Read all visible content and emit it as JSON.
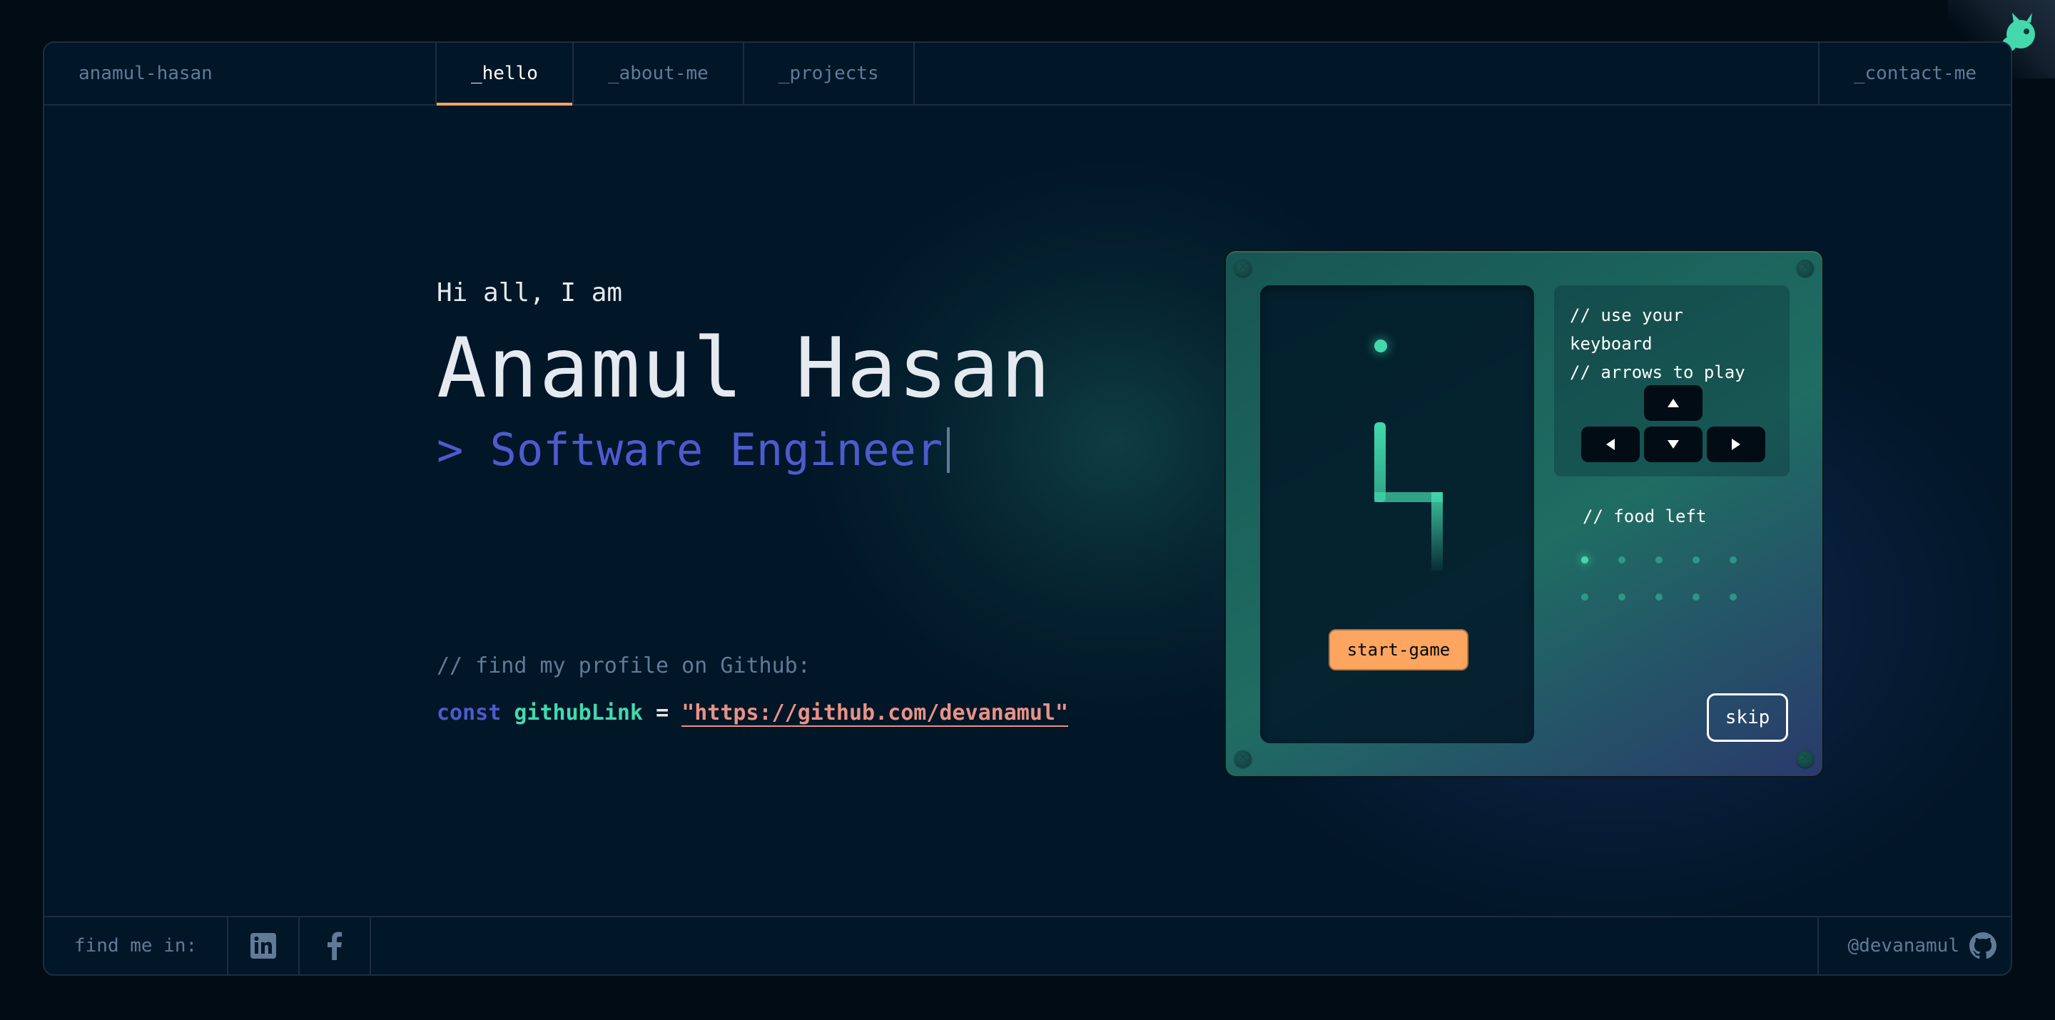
{
  "header": {
    "brand": "anamul-hasan",
    "tabs": [
      {
        "label": "_hello",
        "active": true
      },
      {
        "label": "_about-me",
        "active": false
      },
      {
        "label": "_projects",
        "active": false
      }
    ],
    "contact": "_contact-me"
  },
  "hero": {
    "greeting": "Hi all, I am",
    "name": "Anamul Hasan",
    "role": "> Software Engineer",
    "comment": "// find my profile on Github:",
    "code_keyword": "const",
    "code_var": "githubLink",
    "code_eq": "=",
    "code_string": "\"https://github.com/devanamul\""
  },
  "game": {
    "instructions_line1": "// use your keyboard",
    "instructions_line2": "// arrows to play",
    "food_label": "// food left",
    "food_total": 10,
    "food_eaten": 1,
    "start_label": "start-game",
    "skip_label": "skip"
  },
  "footer": {
    "find_me": "find me in:",
    "socials": [
      "linkedin-icon",
      "facebook-icon"
    ],
    "handle": "@devanamul"
  },
  "colors": {
    "accent_orange": "#fea55f",
    "accent_green": "#43d9ad",
    "accent_blue": "#4d5bce",
    "string_pink": "#e99287",
    "muted": "#607b96",
    "border": "#1e2d3d"
  }
}
